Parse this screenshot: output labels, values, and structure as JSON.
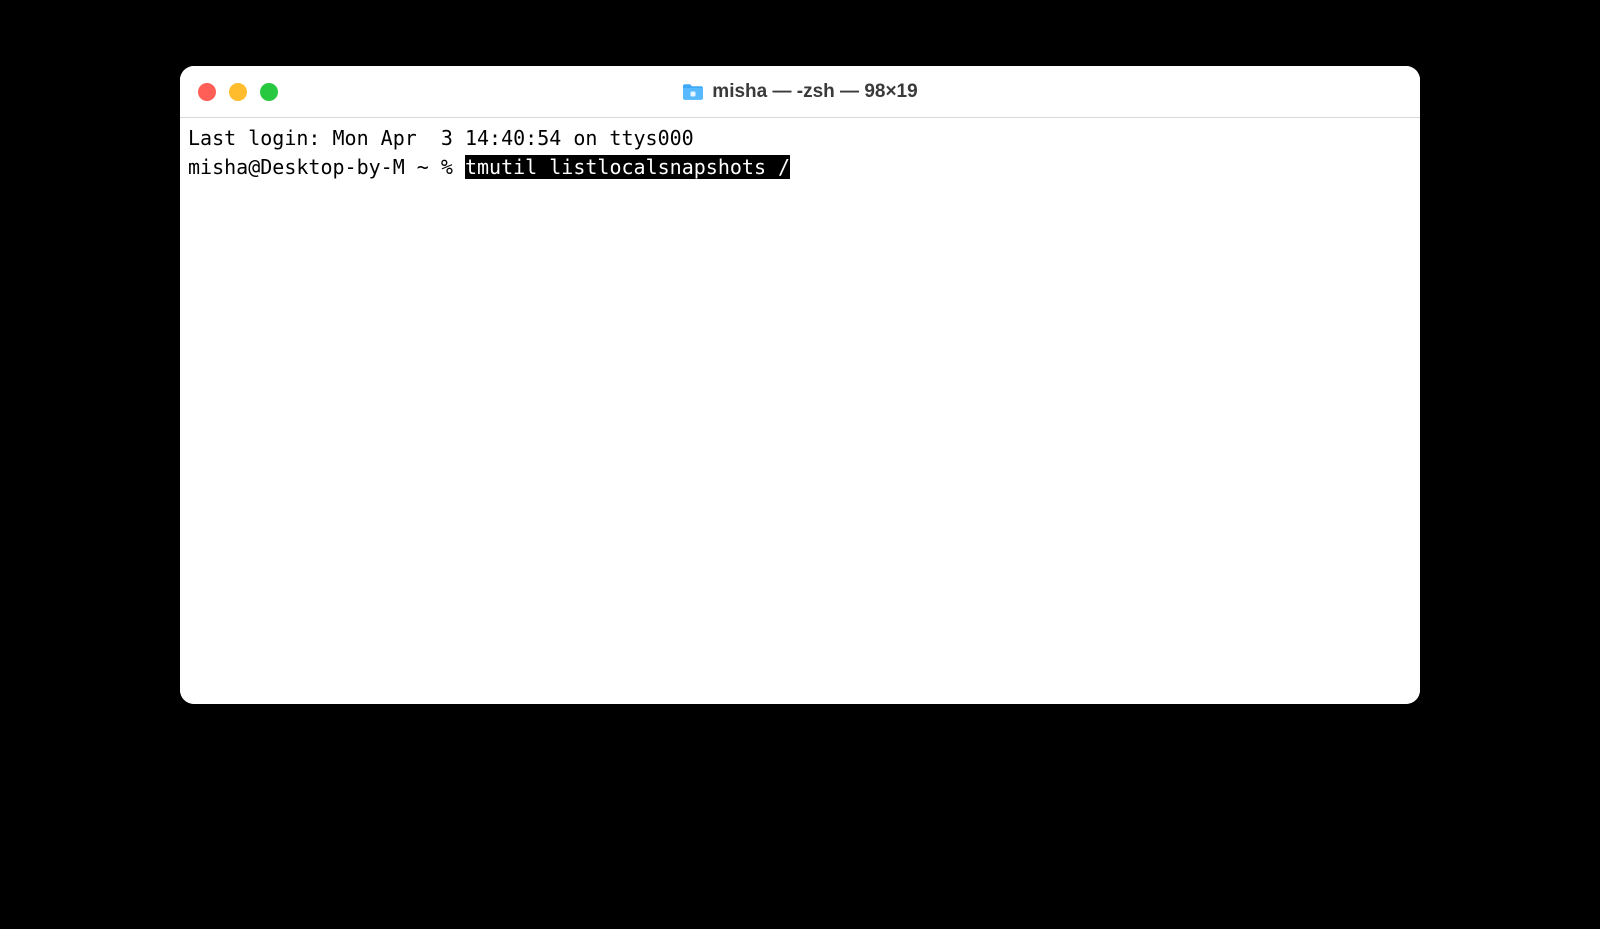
{
  "window": {
    "title": "misha — -zsh — 98×19"
  },
  "terminal": {
    "last_login_line": "Last login: Mon Apr  3 14:40:54 on ttys000",
    "prompt": "misha@Desktop-by-M ~ % ",
    "command_selected": "tmutil listlocalsnapshots /"
  }
}
